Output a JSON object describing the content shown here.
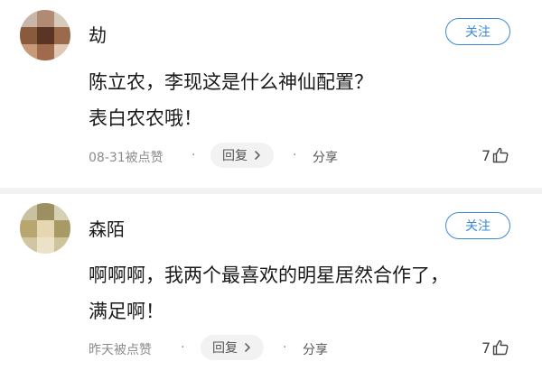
{
  "comments": [
    {
      "name": "劫",
      "follow_label": "关注",
      "lines": [
        "陈立农，李现这是什么神仙配置？",
        "表白农农哦！"
      ],
      "timestamp": "08-31被点赞",
      "separator": "·",
      "reply_label": "回复",
      "share_label": "分享",
      "like_count": "7",
      "avatar_icon": "pixelated-avatar-icon"
    },
    {
      "name": "森陌",
      "follow_label": "关注",
      "lines": [
        "啊啊啊，我两个最喜欢的明星居然合作了，",
        "满足啊！"
      ],
      "timestamp": "昨天被点赞",
      "separator": "·",
      "reply_label": "回复",
      "share_label": "分享",
      "like_count": "7",
      "avatar_icon": "pixelated-avatar-icon"
    }
  ],
  "colors": {
    "accent": "#3b8ad9",
    "text": "#1a1a1a",
    "meta": "#8c8c8c",
    "divider": "#f2f2f2"
  }
}
